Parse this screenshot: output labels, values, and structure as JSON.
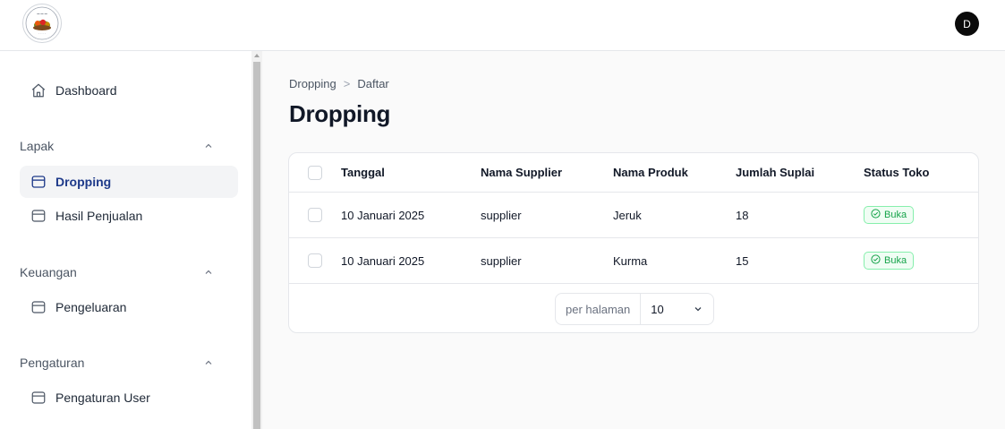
{
  "header": {
    "avatar_initial": "D",
    "logo_icon": "brand-logo-icon"
  },
  "sidebar": {
    "dashboard": {
      "label": "Dashboard",
      "icon": "home-icon"
    },
    "groups": [
      {
        "label": "Lapak",
        "items": [
          {
            "label": "Dropping",
            "icon": "box-icon",
            "active": true
          },
          {
            "label": "Hasil Penjualan",
            "icon": "box-icon",
            "active": false
          }
        ]
      },
      {
        "label": "Keuangan",
        "items": [
          {
            "label": "Pengeluaran",
            "icon": "box-icon",
            "active": false
          }
        ]
      },
      {
        "label": "Pengaturan",
        "items": [
          {
            "label": "Pengaturan User",
            "icon": "box-icon",
            "active": false
          }
        ]
      }
    ]
  },
  "breadcrumb": {
    "items": [
      "Dropping",
      "Daftar"
    ],
    "separator": ">"
  },
  "page": {
    "title": "Dropping"
  },
  "table": {
    "columns": [
      "Tanggal",
      "Nama Supplier",
      "Nama Produk",
      "Jumlah Suplai",
      "Status Toko"
    ],
    "rows": [
      {
        "tanggal": "10 Januari 2025",
        "supplier": "supplier",
        "produk": "Jeruk",
        "jumlah": "18",
        "status": "Buka"
      },
      {
        "tanggal": "10 Januari 2025",
        "supplier": "supplier",
        "produk": "Kurma",
        "jumlah": "15",
        "status": "Buka"
      }
    ]
  },
  "pagination": {
    "per_page_label": "per halaman",
    "per_page_value": "10"
  },
  "colors": {
    "accent": "#1e3a8a",
    "status_open": "#16a34a",
    "status_open_bg": "#f0fdf4",
    "status_open_border": "#86efac"
  }
}
